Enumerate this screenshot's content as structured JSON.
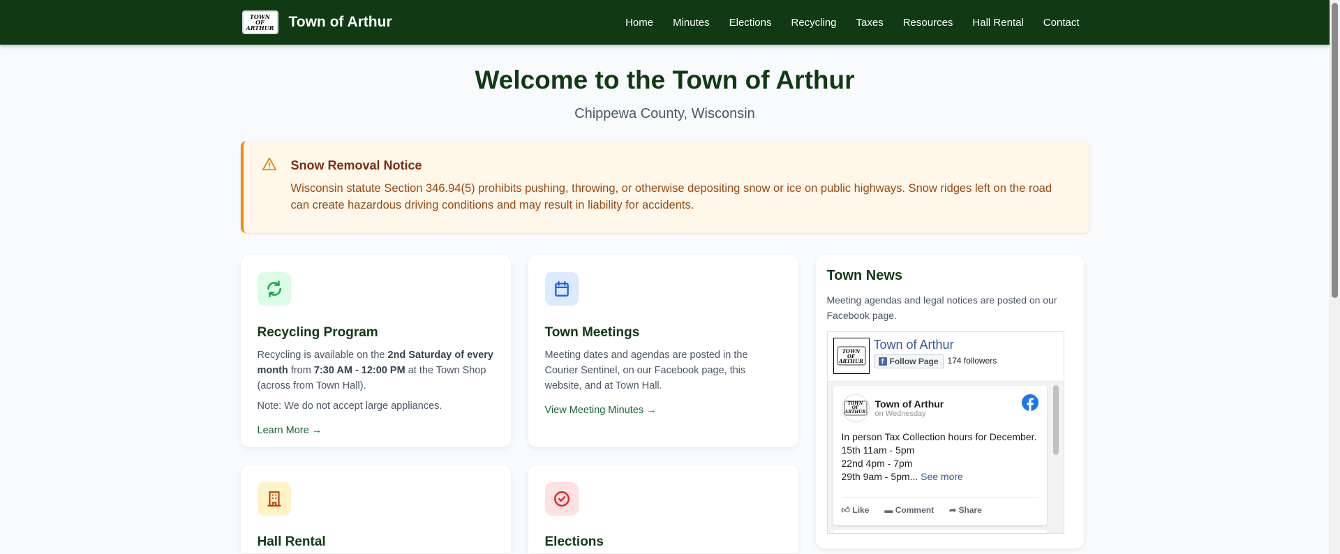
{
  "nav": {
    "logo_text": [
      "TOWN",
      "OF",
      "ARTHUR"
    ],
    "brand": "Town of Arthur",
    "items": [
      "Home",
      "Minutes",
      "Elections",
      "Recycling",
      "Taxes",
      "Resources",
      "Hall Rental",
      "Contact"
    ]
  },
  "hero": {
    "title": "Welcome to the Town of Arthur",
    "subtitle": "Chippewa County, Wisconsin"
  },
  "alert": {
    "title": "Snow Removal Notice",
    "body": "Wisconsin statute Section 346.94(5) prohibits pushing, throwing, or otherwise depositing snow or ice on public highways. Snow ridges left on the road can create hazardous driving conditions and may result in liability for accidents."
  },
  "cards": [
    {
      "title": "Recycling Program",
      "t1": "Recycling is available on the ",
      "b1": "2nd Saturday of every month",
      "t2": " from ",
      "b2": "7:30 AM - 12:00 PM",
      "t3": " at the Town Shop (across from Town Hall).",
      "note": "Note: We do not accept large appliances.",
      "link": "Learn More →"
    },
    {
      "title": "Town Meetings",
      "text": "Meeting dates and agendas are posted in the Courier Sentinel, on our Facebook page, this website, and at Town Hall.",
      "link": "View Meeting Minutes →"
    },
    {
      "title": "Hall Rental"
    },
    {
      "title": "Elections"
    }
  ],
  "news": {
    "title": "Town News",
    "text": "Meeting agendas and legal notices are posted on our Facebook page.",
    "fb": {
      "page_name": "Town of Arthur",
      "follow": "Follow Page",
      "followers": "174 followers",
      "post": {
        "author": "Town of Arthur",
        "time": "on Wednesday",
        "lines": [
          "In person Tax Collection hours for December.",
          "15th 11am - 5pm",
          "22nd 4pm - 7pm",
          "29th 9am - 5pm..."
        ],
        "see_more": "See more",
        "like": "Like",
        "comment": "Comment",
        "share": "Share"
      }
    }
  },
  "colors": {
    "nav": "#0f3a14",
    "accent": "#166534",
    "alert_border": "#f28c0f"
  }
}
